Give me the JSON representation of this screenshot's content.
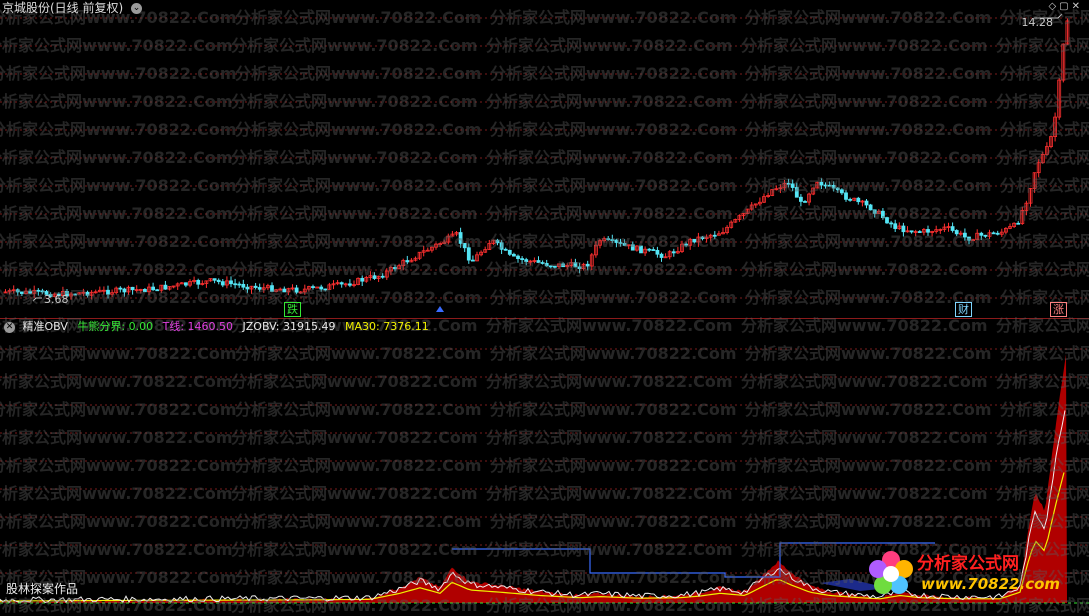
{
  "top_chart": {
    "title": "京城股份(日线 前复权)",
    "high_label": "14.28",
    "low_label": "3.68",
    "badges": {
      "die": "跌",
      "cai": "财",
      "zhang": "涨"
    }
  },
  "indicator": {
    "name": "精准OBV",
    "bull_bear": "牛熊分界: 0.00",
    "t_line": "T线: 1460.50",
    "jzobv": "JZOBV: 31915.49",
    "ma30": "MA30: 7376.11"
  },
  "watermark": "分析家公式网www.70822.Com",
  "author_note": "股林探案作品",
  "logo": {
    "title": "分析家公式网",
    "url": "www.70822.com"
  },
  "colors": {
    "background": "#000000",
    "up": "#ff3030",
    "down": "#54e5f5",
    "grid": "#7a1c1c",
    "obv_fill": "#b00000",
    "obv_neg_fill": "#1c2a8a",
    "t_line": "#e040e0",
    "ma30": "#f0f000",
    "upper_band": "#3a6cff"
  }
}
